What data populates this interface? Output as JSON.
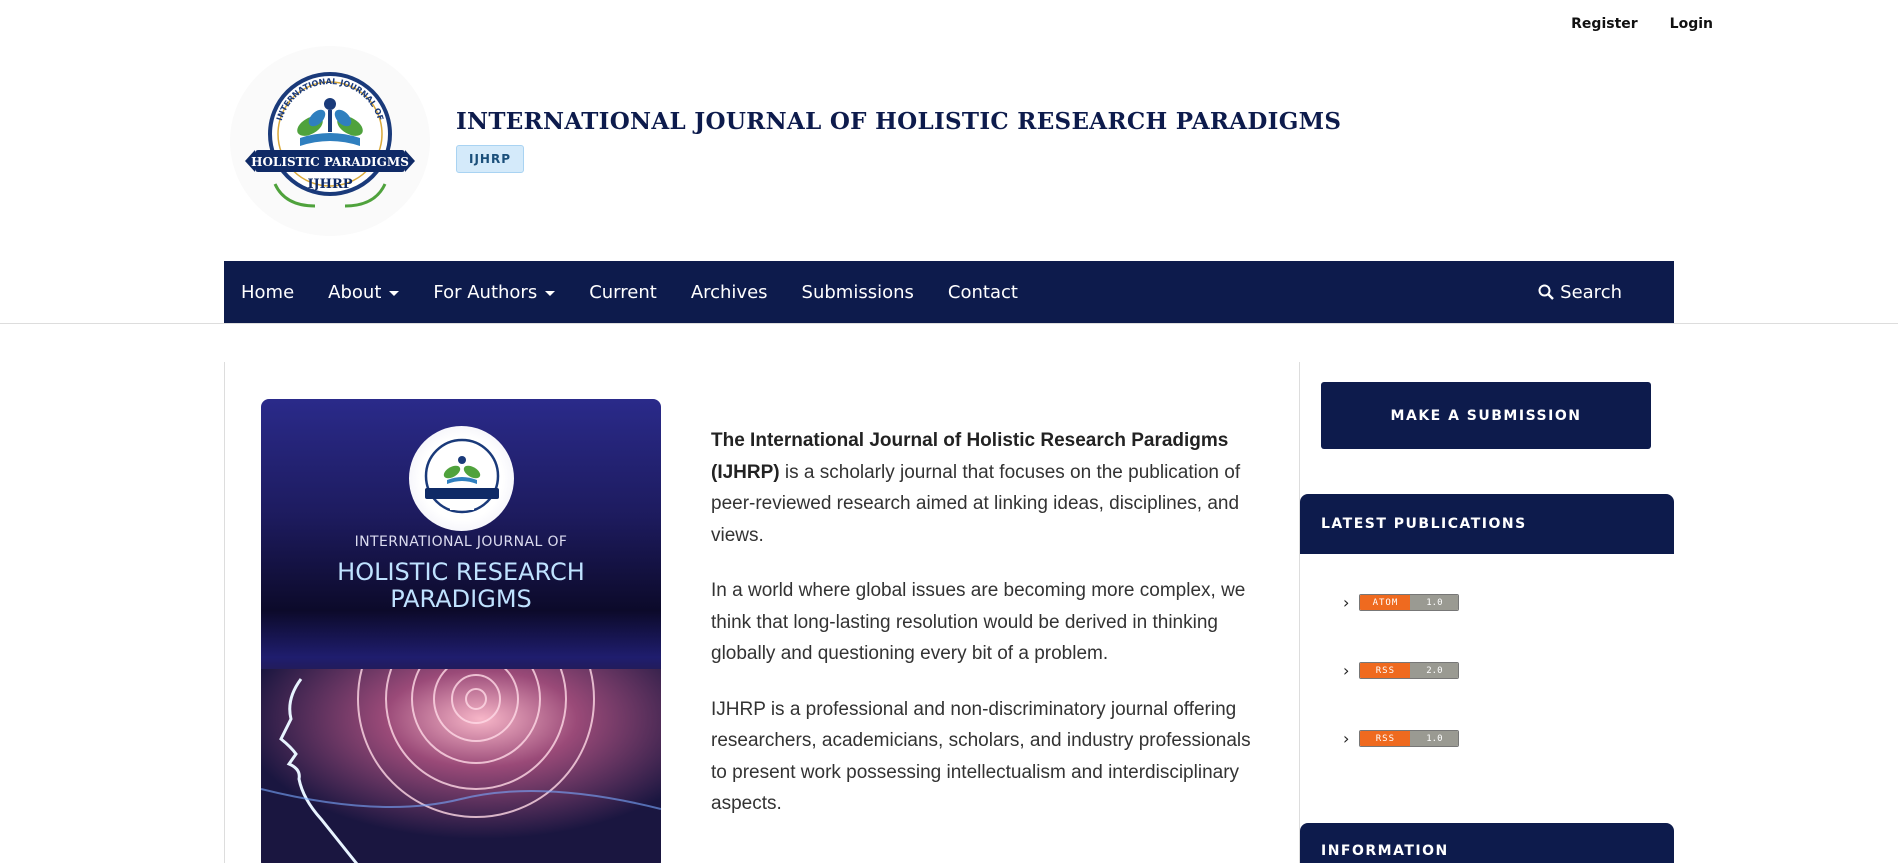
{
  "user_nav": {
    "register": "Register",
    "login": "Login"
  },
  "header": {
    "title": "INTERNATIONAL JOURNAL OF HOLISTIC RESEARCH PARADIGMS",
    "abbreviation": "IJHRP",
    "logo": {
      "ring_text": "INTERNATIONAL JOURNAL OF",
      "banner_text": "HOLISTIC PARADIGMS",
      "abbr": "IJHRP"
    }
  },
  "nav": {
    "items": [
      {
        "label": "Home",
        "dropdown": false
      },
      {
        "label": "About",
        "dropdown": true
      },
      {
        "label": "For Authors",
        "dropdown": true
      },
      {
        "label": "Current",
        "dropdown": false
      },
      {
        "label": "Archives",
        "dropdown": false
      },
      {
        "label": "Submissions",
        "dropdown": false
      },
      {
        "label": "Contact",
        "dropdown": false
      }
    ],
    "search_label": "Search"
  },
  "cover": {
    "line1": "INTERNATIONAL JOURNAL OF",
    "line2a": "HOLISTIC RESEARCH",
    "line2b": "PARADIGMS"
  },
  "intro": {
    "p1_bold": "The International Journal of Holistic Research Paradigms (IJHRP)",
    "p1_rest": " is a scholarly journal that focuses on the publication of peer-reviewed research aimed at linking ideas, disciplines, and views.",
    "p2": "In a world where global issues are becoming more complex, we think that long-lasting resolution would be derived in thinking globally and questioning every bit of a problem.",
    "p3": "IJHRP is a professional and non-discriminatory journal offering researchers, academicians, scholars, and industry professionals to present work possessing intellectualism and interdisciplinary aspects."
  },
  "sidebar": {
    "submit_label": "MAKE A SUBMISSION",
    "latest_heading": "LATEST PUBLICATIONS",
    "feeds": [
      {
        "format": "ATOM",
        "version": "1.0"
      },
      {
        "format": "RSS",
        "version": "2.0"
      },
      {
        "format": "RSS",
        "version": "1.0"
      }
    ],
    "info_heading": "INFORMATION"
  },
  "colors": {
    "brand_navy": "#0d1b4c",
    "badge_bg": "#d4eafa",
    "feed_orange": "#ef6a1f"
  }
}
